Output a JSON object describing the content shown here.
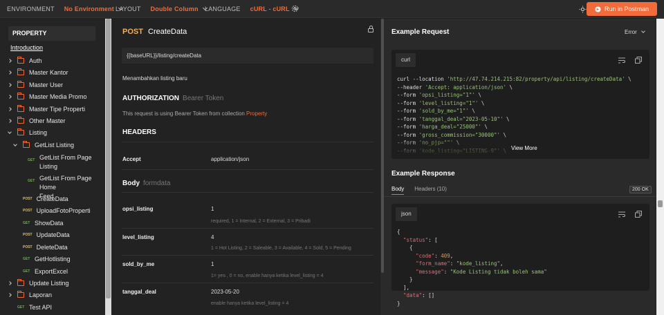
{
  "topbar": {
    "environment_label": "ENVIRONMENT",
    "environment_value": "No Environment",
    "layout_label": "LAYOUT",
    "layout_value": "Double Column",
    "language_label": "LANGUAGE",
    "language_value": "cURL - cURL",
    "run_button": "Run in Postman"
  },
  "sidebar": {
    "heading": "PROPERTY",
    "intro_link": "Introduction",
    "folders": [
      "Auth",
      "Master Kantor",
      "Master User",
      "Master Media Promo",
      "Master Tipe Properti",
      "Other Master",
      "Listing"
    ],
    "subfolder": "GetList Listing",
    "sub_items": [
      {
        "method": "GET",
        "line1": "GetList From Page",
        "line2": "Listing"
      },
      {
        "method": "GET",
        "line1": "GetList From Page Home",
        "line2": "Feed"
      }
    ],
    "items": [
      {
        "method": "POST",
        "label": "CreateData"
      },
      {
        "method": "POST",
        "label": "UploadFotoProperti"
      },
      {
        "method": "GET",
        "label": "ShowData"
      },
      {
        "method": "POST",
        "label": "UpdateData"
      },
      {
        "method": "POST",
        "label": "DeleteData"
      },
      {
        "method": "GET",
        "label": "GetHotlisting"
      },
      {
        "method": "GET",
        "label": "ExportExcel"
      }
    ],
    "bottom_folders": [
      "Update Listing",
      "Laporan"
    ],
    "test_api": {
      "method": "GET",
      "label": "Test API"
    }
  },
  "request": {
    "method": "POST",
    "name": "CreateData",
    "url": "{{baseURL}}/listing/createData",
    "description": "Menambahkan listing baru",
    "auth_title": "AUTHORIZATION",
    "auth_type": "Bearer Token",
    "auth_text": "This request is using Bearer Token from collection ",
    "auth_collection": "Property",
    "headers_title": "HEADERS",
    "header_key": "Accept",
    "header_value": "application/json",
    "body_title": "Body",
    "body_type": "formdata",
    "params": [
      {
        "key": "opsi_listing",
        "value": "1",
        "desc": "required, 1 = Internal, 2 = External, 3 = Pribadi"
      },
      {
        "key": "level_listing",
        "value": "4",
        "desc": "1 = Hot Listing, 2 = Saleable, 3 = Available, 4 = Sold, 5 = Pending"
      },
      {
        "key": "sold_by_me",
        "value": "1",
        "desc": "1= yes , 0 = no, enable hanya ketika level_listing = 4"
      },
      {
        "key": "tanggal_deal",
        "value": "2023-05-20",
        "desc": "enable hanya ketika level_listing = 4"
      }
    ]
  },
  "example_request": {
    "title": "Example Request",
    "selector": "Error",
    "lang": "curl",
    "view_more": "View More",
    "lines": [
      {
        "a": "curl --location ",
        "s": "'http://47.74.214.215:82/property/api/listing/createData'",
        "b": " \\"
      },
      {
        "a": "--header ",
        "s": "'Accept: application/json'",
        "b": " \\"
      },
      {
        "a": "--form ",
        "s": "'opsi_listing=\"1\"'",
        "b": " \\"
      },
      {
        "a": "--form ",
        "s": "'level_listing=\"1\"'",
        "b": " \\"
      },
      {
        "a": "--form ",
        "s": "'sold_by_me=\"1\"'",
        "b": " \\"
      },
      {
        "a": "--form ",
        "s": "'tanggal_deal=\"2023-05-10\"'",
        "b": " \\"
      },
      {
        "a": "--form ",
        "s": "'harga_deal=\"25000\"'",
        "b": " \\"
      },
      {
        "a": "--form ",
        "s": "'gross_commission=\"30000\"'",
        "b": " \\"
      },
      {
        "a": "--form ",
        "s": "'no_pjp=\"\"'",
        "b": " \\"
      },
      {
        "a": "--form ",
        "s": "'kode_listing=\"LISTING-9\"'",
        "b": " \\"
      }
    ]
  },
  "example_response": {
    "title": "Example Response",
    "tab_body": "Body",
    "tab_headers": "Headers (10)",
    "status_badge": "200 OK",
    "lang": "json",
    "lines": [
      "{",
      "  \"status\": [",
      "    {",
      "      \"code\": 409,",
      "      \"form_name\": \"kode_listing\",",
      "      \"message\": \"Kode Listing tidak boleh sama\"",
      "    }",
      "  ],",
      "  \"data\": []",
      "}"
    ]
  }
}
